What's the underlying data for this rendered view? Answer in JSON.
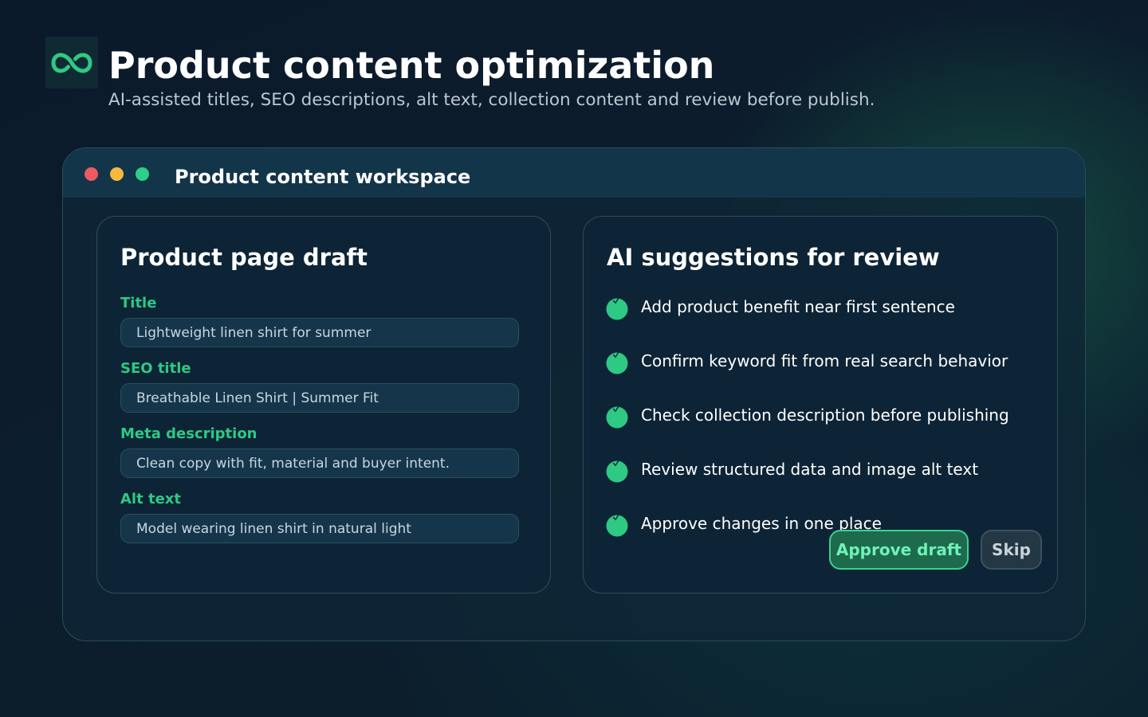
{
  "header": {
    "title": "Product content optimization",
    "subtitle": "AI-assisted titles, SEO descriptions, alt text, collection content and review before publish.",
    "logo_icon": "infinity-icon"
  },
  "window": {
    "title": "Product content workspace"
  },
  "draft_panel": {
    "title": "Product page draft",
    "fields": [
      {
        "label": "Title",
        "value": "Lightweight linen shirt for summer"
      },
      {
        "label": "SEO title",
        "value": "Breathable Linen Shirt | Summer Fit"
      },
      {
        "label": "Meta description",
        "value": "Clean copy with fit, material and buyer intent."
      },
      {
        "label": "Alt text",
        "value": "Model wearing linen shirt in natural light"
      }
    ]
  },
  "suggestions_panel": {
    "title": "AI suggestions for review",
    "items": [
      "Add product benefit near first sentence",
      "Confirm keyword fit from real search behavior",
      "Check collection description before publishing",
      "Review structured data and image alt text",
      "Approve changes in one place"
    ],
    "approve_label": "Approve draft",
    "skip_label": "Skip"
  },
  "colors": {
    "accent": "#2ec983",
    "background": "#0b1a2b",
    "panel": "#0d2436",
    "titlebar": "#13354a",
    "dot_red": "#ec5b5f",
    "dot_yellow": "#f6b83f",
    "dot_green": "#2ecf86"
  }
}
